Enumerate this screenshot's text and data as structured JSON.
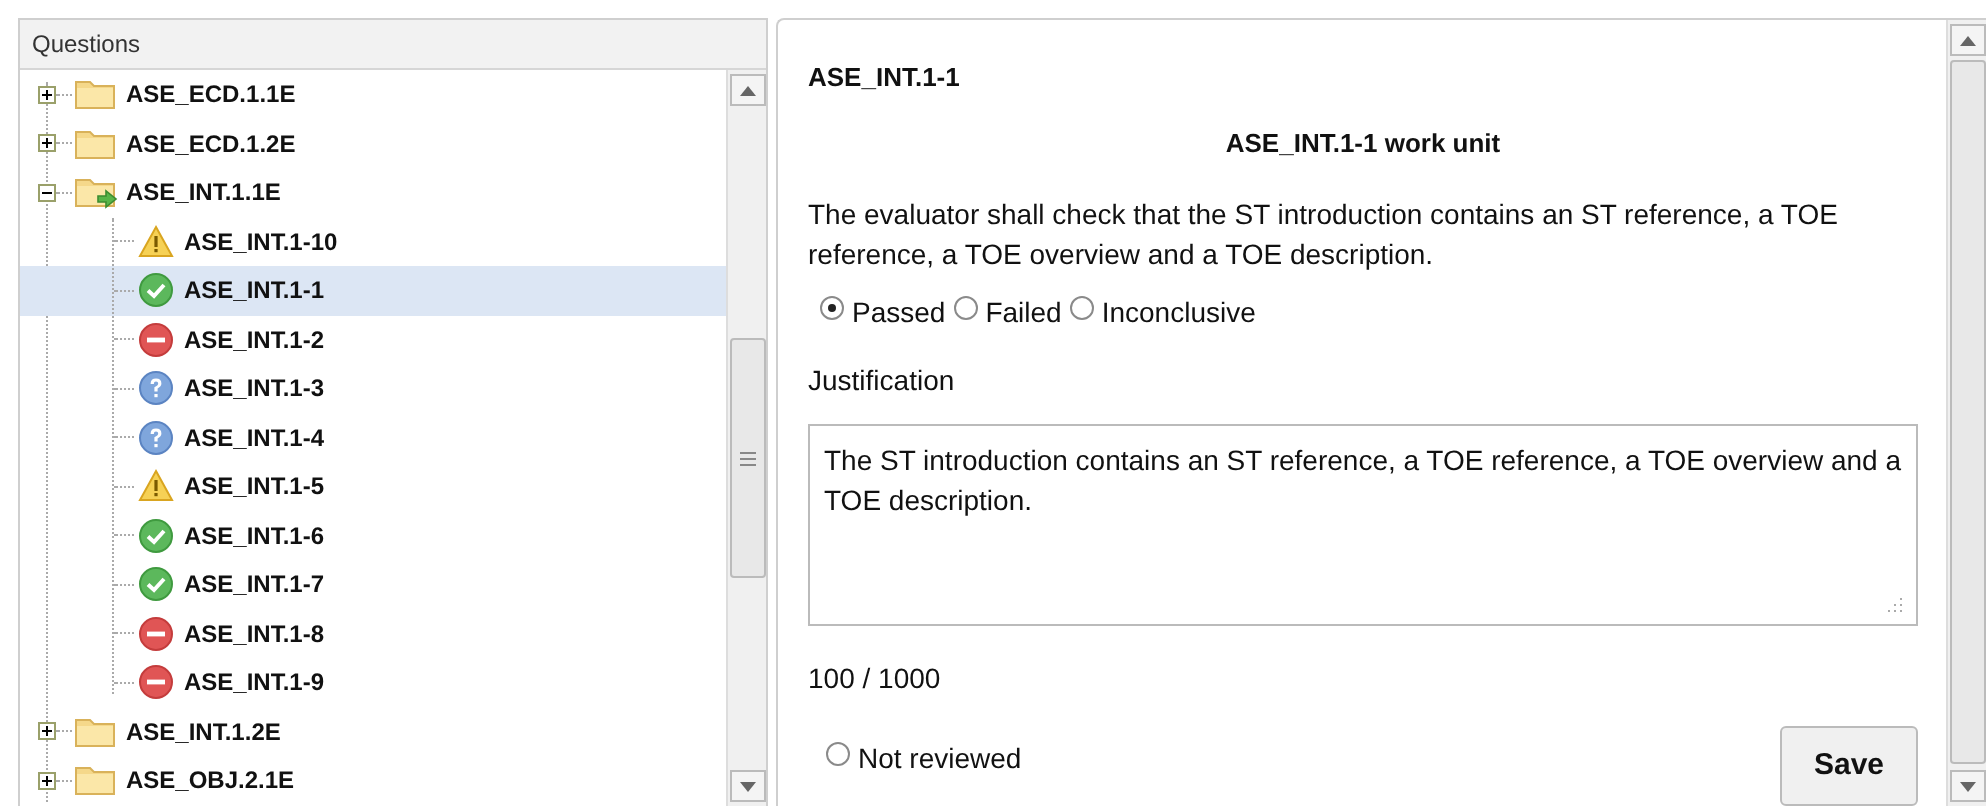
{
  "tree": {
    "title": "Questions",
    "items": [
      {
        "label": "ASE_ECD.1.1E",
        "expanded": false,
        "selected": false
      },
      {
        "label": "ASE_ECD.1.2E",
        "expanded": false,
        "selected": false
      },
      {
        "label": "ASE_INT.1.1E",
        "expanded": true,
        "selected": false,
        "children": [
          {
            "label": "ASE_INT.1-10",
            "kind": "warning",
            "selected": false
          },
          {
            "label": "ASE_INT.1-1",
            "kind": "passed",
            "selected": true
          },
          {
            "label": "ASE_INT.1-2",
            "kind": "failed",
            "selected": false
          },
          {
            "label": "ASE_INT.1-3",
            "kind": "unknown",
            "selected": false
          },
          {
            "label": "ASE_INT.1-4",
            "kind": "unknown",
            "selected": false
          },
          {
            "label": "ASE_INT.1-5",
            "kind": "warning",
            "selected": false
          },
          {
            "label": "ASE_INT.1-6",
            "kind": "passed",
            "selected": false
          },
          {
            "label": "ASE_INT.1-7",
            "kind": "passed",
            "selected": false
          },
          {
            "label": "ASE_INT.1-8",
            "kind": "failed",
            "selected": false
          },
          {
            "label": "ASE_INT.1-9",
            "kind": "failed",
            "selected": false
          }
        ]
      },
      {
        "label": "ASE_INT.1.2E",
        "expanded": false,
        "selected": false
      },
      {
        "label": "ASE_OBJ.2.1E",
        "expanded": false,
        "selected": false
      }
    ]
  },
  "detail": {
    "heading": "ASE_INT.1-1",
    "title": "ASE_INT.1-1 work unit",
    "description": "The evaluator shall check that the ST introduction contains an ST reference, a TOE reference, a TOE overview and a TOE description.",
    "verdicts": [
      {
        "label": "Passed",
        "selected": true
      },
      {
        "label": "Failed",
        "selected": false
      },
      {
        "label": "Inconclusive",
        "selected": false
      }
    ],
    "justification_label": "Justification",
    "justification": "The ST introduction contains an ST reference, a TOE reference, a TOE overview and a TOE description.",
    "counter": "100 / 1000",
    "review": {
      "label": "Not reviewed",
      "selected": false
    },
    "save": "Save"
  }
}
